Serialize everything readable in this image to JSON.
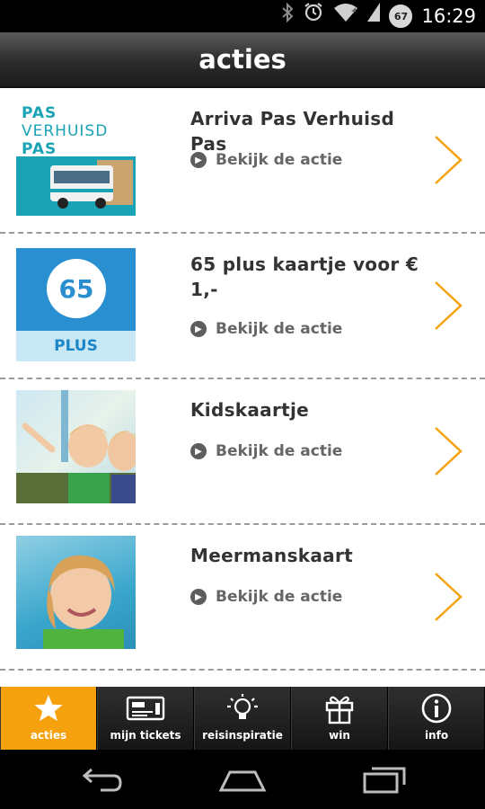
{
  "status_bar": {
    "time": "16:29",
    "battery": "67",
    "icons": [
      "bluetooth-icon",
      "alarm-icon",
      "wifi-icon",
      "signal-icon"
    ]
  },
  "header": {
    "title": "acties"
  },
  "actions": [
    {
      "title": "Arriva Pas Verhuisd Pas",
      "link": "Bekijk de actie",
      "thumb_lines": [
        "PAS",
        "VERHUISD",
        "PAS"
      ]
    },
    {
      "title": "65 plus kaartje voor € 1,-",
      "link": "Bekijk de actie",
      "thumb_badge": "65",
      "thumb_label": "PLUS"
    },
    {
      "title": "Kidskaartje",
      "link": "Bekijk de actie"
    },
    {
      "title": "Meermanskaart",
      "link": "Bekijk de actie"
    }
  ],
  "tabs": [
    {
      "label": "acties",
      "icon": "star-icon",
      "active": true
    },
    {
      "label": "mijn tickets",
      "icon": "ticket-icon",
      "active": false
    },
    {
      "label": "reisinspiratie",
      "icon": "lightbulb-icon",
      "active": false
    },
    {
      "label": "win",
      "icon": "gift-icon",
      "active": false
    },
    {
      "label": "info",
      "icon": "info-icon",
      "active": false
    }
  ],
  "colors": {
    "accent": "#f6a20f",
    "teal": "#1aa3b5",
    "blue": "#2a8fd1"
  }
}
